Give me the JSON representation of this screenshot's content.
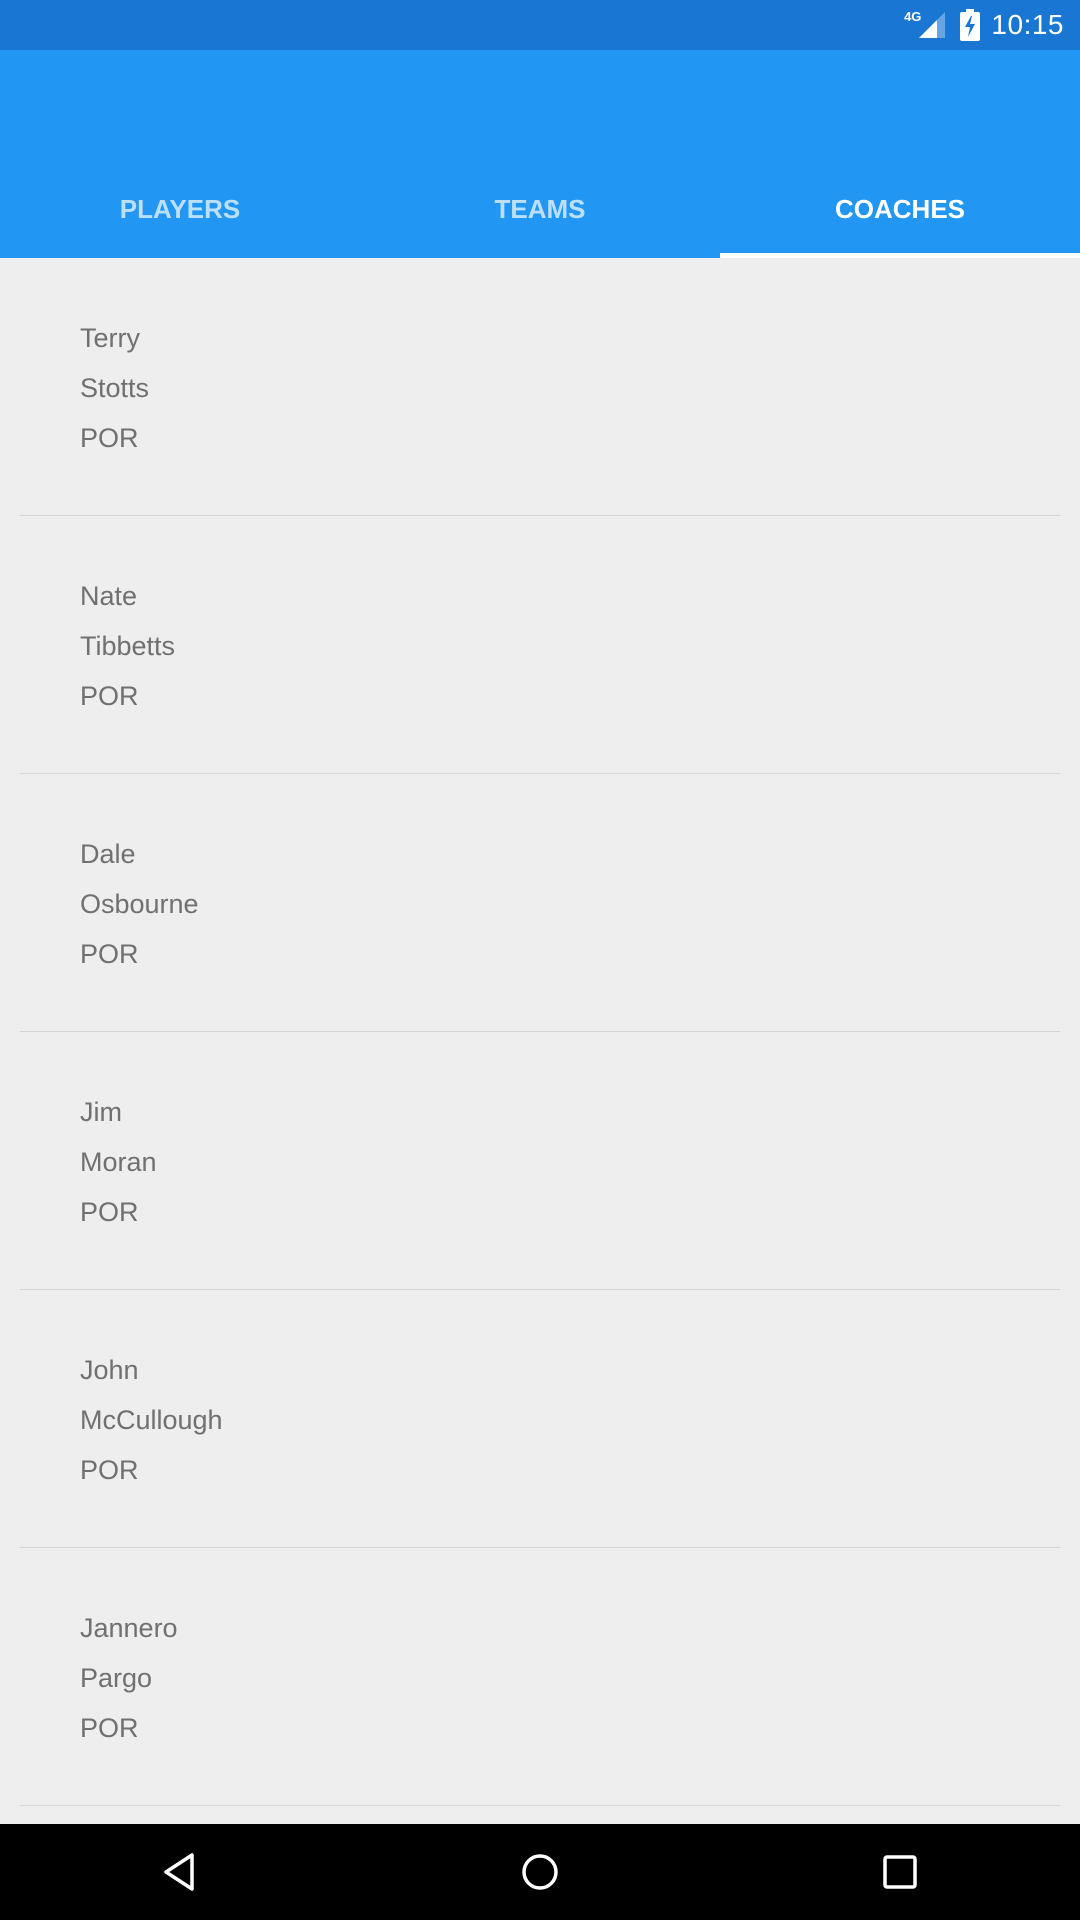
{
  "status_bar": {
    "network": "4G",
    "time": "10:15",
    "icons": [
      "signal-icon",
      "battery-charging-icon"
    ]
  },
  "tabs": [
    {
      "label": "PLAYERS",
      "active": false
    },
    {
      "label": "TEAMS",
      "active": false
    },
    {
      "label": "COACHES",
      "active": true
    }
  ],
  "coaches": [
    {
      "first": "Terry",
      "last": "Stotts",
      "team": "POR"
    },
    {
      "first": "Nate",
      "last": "Tibbetts",
      "team": "POR"
    },
    {
      "first": "Dale",
      "last": "Osbourne",
      "team": "POR"
    },
    {
      "first": "Jim",
      "last": "Moran",
      "team": "POR"
    },
    {
      "first": "John",
      "last": "McCullough",
      "team": "POR"
    },
    {
      "first": "Jannero",
      "last": "Pargo",
      "team": "POR"
    }
  ],
  "nav_bar": {
    "icons": [
      "back-icon",
      "home-icon",
      "recents-icon"
    ]
  },
  "colors": {
    "status_bar": "#1976d2",
    "app_bar": "#2196f3",
    "background": "#eeeeee",
    "text": "#707070"
  }
}
